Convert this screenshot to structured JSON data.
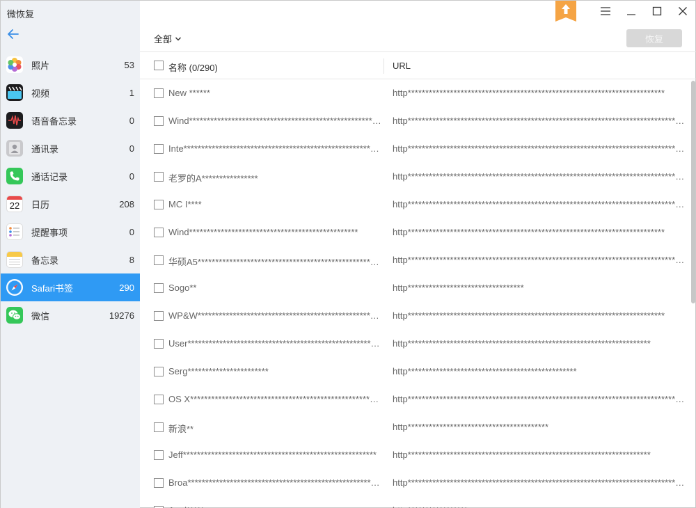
{
  "app": {
    "title": "微恢复"
  },
  "sidebar": {
    "items": [
      {
        "label": "照片",
        "count": "53",
        "icon": "photos-icon",
        "active": false
      },
      {
        "label": "视频",
        "count": "1",
        "icon": "video-icon",
        "active": false
      },
      {
        "label": "语音备忘录",
        "count": "0",
        "icon": "voice-memo-icon",
        "active": false
      },
      {
        "label": "通讯录",
        "count": "0",
        "icon": "contacts-icon",
        "active": false
      },
      {
        "label": "通话记录",
        "count": "0",
        "icon": "phone-icon",
        "active": false
      },
      {
        "label": "日历",
        "count": "208",
        "icon": "calendar-icon",
        "active": false,
        "icon_text": "22"
      },
      {
        "label": "提醒事项",
        "count": "0",
        "icon": "reminders-icon",
        "active": false
      },
      {
        "label": "备忘录",
        "count": "8",
        "icon": "notes-icon",
        "active": false
      },
      {
        "label": "Safari书签",
        "count": "290",
        "icon": "safari-icon",
        "active": true
      },
      {
        "label": "微信",
        "count": "19276",
        "icon": "wechat-icon",
        "active": false
      }
    ]
  },
  "toolbar": {
    "filter_label": "全部",
    "restore_label": "恢复"
  },
  "table": {
    "headers": {
      "name": "名称 (0/290)",
      "url": "URL"
    },
    "rows": [
      {
        "name": "New ******",
        "url": "http*************************************************************************"
      },
      {
        "name": "Wind************************************************************************",
        "url": "http*********************************************************************************************"
      },
      {
        "name": "Inte************************************************************************",
        "url": "http*********************************************************************************************"
      },
      {
        "name": "老罗的A****************",
        "url": "http*********************************************************************************************"
      },
      {
        "name": "MC I****",
        "url": "http*********************************************************************************************"
      },
      {
        "name": "Wind************************************************",
        "url": "http*************************************************************************"
      },
      {
        "name": "华硕A5************************************************************************",
        "url": "http*********************************************************************************************"
      },
      {
        "name": "Sogo**",
        "url": "http*********************************"
      },
      {
        "name": "WP&W************************************************************************",
        "url": "http*************************************************************************"
      },
      {
        "name": "User************************************************************************",
        "url": "http*********************************************************************"
      },
      {
        "name": "Serg***********************",
        "url": "http************************************************"
      },
      {
        "name": "OS X************************************************************************",
        "url": "http*********************************************************************************************"
      },
      {
        "name": "新浪**",
        "url": "http****************************************"
      },
      {
        "name": "Jeff*******************************************************",
        "url": "http*********************************************************************"
      },
      {
        "name": "Broa************************************************************************",
        "url": "http*********************************************************************************************"
      },
      {
        "name": "Appl*****",
        "url": "http*****************"
      }
    ]
  },
  "colors": {
    "accent": "#2f9af4",
    "sidebar_bg": "#eef1f5",
    "upgrade": "#f5a444"
  }
}
